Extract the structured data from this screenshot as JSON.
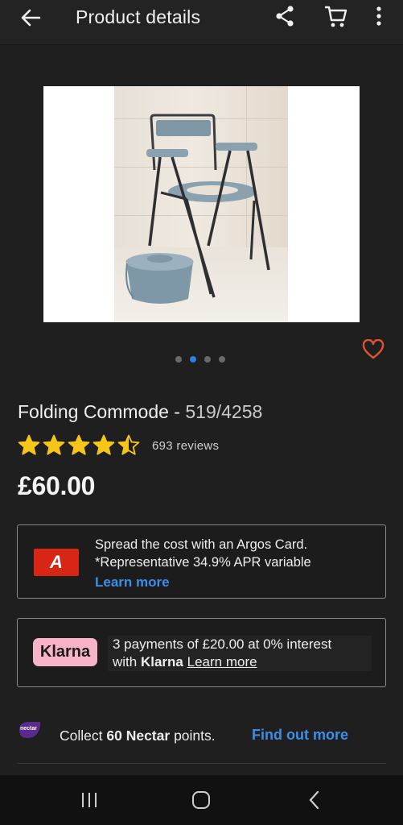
{
  "appbar": {
    "title": "Product details",
    "icons": [
      "back-arrow-icon",
      "share-icon",
      "cart-icon",
      "more-vertical-icon"
    ]
  },
  "gallery": {
    "image_subject": "Folding commode chair with bucket",
    "dot_count": 4,
    "active_dot": 2
  },
  "product": {
    "name": "Folding Commode -",
    "code": "519/4258",
    "rating_stars": 4.5,
    "reviews": "693 reviews",
    "price": "£60.00"
  },
  "argos_card": {
    "logo_letter": "A",
    "line1": "Spread the cost with an Argos Card.",
    "line2": "*Representative 34.9% APR variable",
    "link": "Learn more"
  },
  "klarna": {
    "badge": "Klarna",
    "line1": "3 payments of £20.00 at 0% interest",
    "line2_prefix": "with",
    "line2_brand": "Klarna",
    "link": "Learn more"
  },
  "nectar": {
    "logo_text": "nectar",
    "prefix": "Collect",
    "points": "60 Nectar",
    "suffix": "points.",
    "link": "Find out more"
  },
  "colors": {
    "background": "#1f1f1f",
    "accent_blue": "#3d8ee8",
    "star_yellow": "#f5c518",
    "argos_red": "#d72516",
    "klarna_pink": "#f7b4c9",
    "nectar_purple": "#5a2a8c",
    "favorite_orange": "#e0552f"
  }
}
